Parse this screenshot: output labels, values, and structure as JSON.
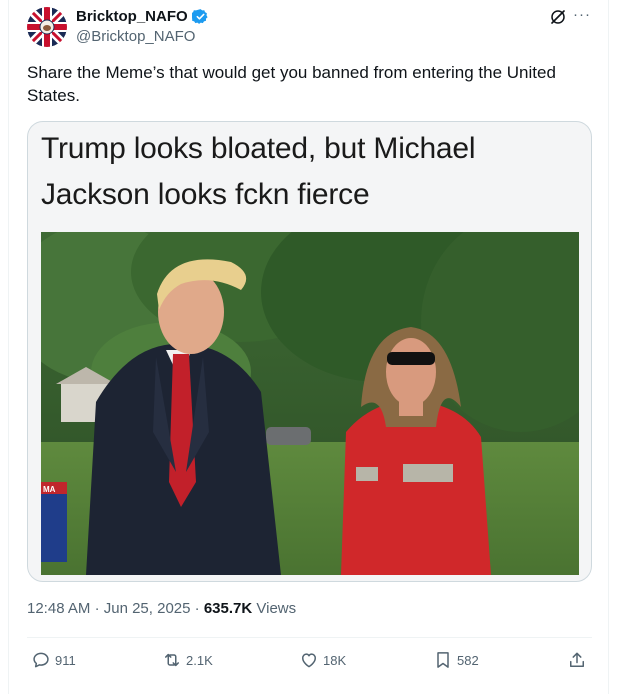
{
  "author": {
    "display_name": "Bricktop_NAFO",
    "handle": "@Bricktop_NAFO",
    "verified_icon": "verified-badge-icon"
  },
  "tweet": {
    "text": "Share the Meme’s that would get you banned from entering the United States."
  },
  "media": {
    "caption_line1": "Trump looks bloated, but Michael",
    "caption_line2": "Jackson looks fckn fierce",
    "sign_text": "MA"
  },
  "meta": {
    "time": "12:48 AM",
    "separator": "·",
    "date": "Jun 25, 2025",
    "views_count": "635.7K",
    "views_label": "Views"
  },
  "actions": {
    "replies": "911",
    "reposts": "2.1K",
    "likes": "18K",
    "bookmarks": "582"
  },
  "colors": {
    "accent": "#1d9bf0",
    "text": "#0f1419",
    "muted": "#536471"
  }
}
